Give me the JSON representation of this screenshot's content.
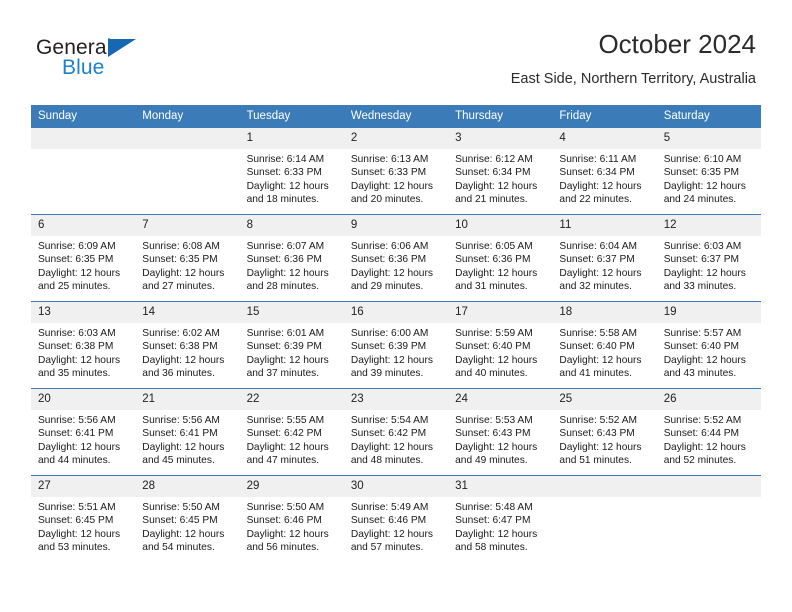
{
  "brand": {
    "name_part1": "General",
    "name_part2": "Blue",
    "triangle_color": "#1668b3",
    "blue_color": "#1b7fd4"
  },
  "header": {
    "title": "October 2024",
    "subtitle": "East Side, Northern Territory, Australia"
  },
  "theme": {
    "header_blue": "#3b7cb8",
    "daynum_band": "#f0f0f0"
  },
  "weekday_headers": [
    "Sunday",
    "Monday",
    "Tuesday",
    "Wednesday",
    "Thursday",
    "Friday",
    "Saturday"
  ],
  "labels": {
    "sunrise_prefix": "Sunrise:",
    "sunset_prefix": "Sunset:",
    "daylight_prefix": "Daylight:"
  },
  "weeks": [
    [
      {
        "day": "",
        "lines": []
      },
      {
        "day": "",
        "lines": []
      },
      {
        "day": "1",
        "lines": [
          "Sunrise: 6:14 AM",
          "Sunset: 6:33 PM",
          "Daylight: 12 hours",
          "and 18 minutes."
        ]
      },
      {
        "day": "2",
        "lines": [
          "Sunrise: 6:13 AM",
          "Sunset: 6:33 PM",
          "Daylight: 12 hours",
          "and 20 minutes."
        ]
      },
      {
        "day": "3",
        "lines": [
          "Sunrise: 6:12 AM",
          "Sunset: 6:34 PM",
          "Daylight: 12 hours",
          "and 21 minutes."
        ]
      },
      {
        "day": "4",
        "lines": [
          "Sunrise: 6:11 AM",
          "Sunset: 6:34 PM",
          "Daylight: 12 hours",
          "and 22 minutes."
        ]
      },
      {
        "day": "5",
        "lines": [
          "Sunrise: 6:10 AM",
          "Sunset: 6:35 PM",
          "Daylight: 12 hours",
          "and 24 minutes."
        ]
      }
    ],
    [
      {
        "day": "6",
        "lines": [
          "Sunrise: 6:09 AM",
          "Sunset: 6:35 PM",
          "Daylight: 12 hours",
          "and 25 minutes."
        ]
      },
      {
        "day": "7",
        "lines": [
          "Sunrise: 6:08 AM",
          "Sunset: 6:35 PM",
          "Daylight: 12 hours",
          "and 27 minutes."
        ]
      },
      {
        "day": "8",
        "lines": [
          "Sunrise: 6:07 AM",
          "Sunset: 6:36 PM",
          "Daylight: 12 hours",
          "and 28 minutes."
        ]
      },
      {
        "day": "9",
        "lines": [
          "Sunrise: 6:06 AM",
          "Sunset: 6:36 PM",
          "Daylight: 12 hours",
          "and 29 minutes."
        ]
      },
      {
        "day": "10",
        "lines": [
          "Sunrise: 6:05 AM",
          "Sunset: 6:36 PM",
          "Daylight: 12 hours",
          "and 31 minutes."
        ]
      },
      {
        "day": "11",
        "lines": [
          "Sunrise: 6:04 AM",
          "Sunset: 6:37 PM",
          "Daylight: 12 hours",
          "and 32 minutes."
        ]
      },
      {
        "day": "12",
        "lines": [
          "Sunrise: 6:03 AM",
          "Sunset: 6:37 PM",
          "Daylight: 12 hours",
          "and 33 minutes."
        ]
      }
    ],
    [
      {
        "day": "13",
        "lines": [
          "Sunrise: 6:03 AM",
          "Sunset: 6:38 PM",
          "Daylight: 12 hours",
          "and 35 minutes."
        ]
      },
      {
        "day": "14",
        "lines": [
          "Sunrise: 6:02 AM",
          "Sunset: 6:38 PM",
          "Daylight: 12 hours",
          "and 36 minutes."
        ]
      },
      {
        "day": "15",
        "lines": [
          "Sunrise: 6:01 AM",
          "Sunset: 6:39 PM",
          "Daylight: 12 hours",
          "and 37 minutes."
        ]
      },
      {
        "day": "16",
        "lines": [
          "Sunrise: 6:00 AM",
          "Sunset: 6:39 PM",
          "Daylight: 12 hours",
          "and 39 minutes."
        ]
      },
      {
        "day": "17",
        "lines": [
          "Sunrise: 5:59 AM",
          "Sunset: 6:40 PM",
          "Daylight: 12 hours",
          "and 40 minutes."
        ]
      },
      {
        "day": "18",
        "lines": [
          "Sunrise: 5:58 AM",
          "Sunset: 6:40 PM",
          "Daylight: 12 hours",
          "and 41 minutes."
        ]
      },
      {
        "day": "19",
        "lines": [
          "Sunrise: 5:57 AM",
          "Sunset: 6:40 PM",
          "Daylight: 12 hours",
          "and 43 minutes."
        ]
      }
    ],
    [
      {
        "day": "20",
        "lines": [
          "Sunrise: 5:56 AM",
          "Sunset: 6:41 PM",
          "Daylight: 12 hours",
          "and 44 minutes."
        ]
      },
      {
        "day": "21",
        "lines": [
          "Sunrise: 5:56 AM",
          "Sunset: 6:41 PM",
          "Daylight: 12 hours",
          "and 45 minutes."
        ]
      },
      {
        "day": "22",
        "lines": [
          "Sunrise: 5:55 AM",
          "Sunset: 6:42 PM",
          "Daylight: 12 hours",
          "and 47 minutes."
        ]
      },
      {
        "day": "23",
        "lines": [
          "Sunrise: 5:54 AM",
          "Sunset: 6:42 PM",
          "Daylight: 12 hours",
          "and 48 minutes."
        ]
      },
      {
        "day": "24",
        "lines": [
          "Sunrise: 5:53 AM",
          "Sunset: 6:43 PM",
          "Daylight: 12 hours",
          "and 49 minutes."
        ]
      },
      {
        "day": "25",
        "lines": [
          "Sunrise: 5:52 AM",
          "Sunset: 6:43 PM",
          "Daylight: 12 hours",
          "and 51 minutes."
        ]
      },
      {
        "day": "26",
        "lines": [
          "Sunrise: 5:52 AM",
          "Sunset: 6:44 PM",
          "Daylight: 12 hours",
          "and 52 minutes."
        ]
      }
    ],
    [
      {
        "day": "27",
        "lines": [
          "Sunrise: 5:51 AM",
          "Sunset: 6:45 PM",
          "Daylight: 12 hours",
          "and 53 minutes."
        ]
      },
      {
        "day": "28",
        "lines": [
          "Sunrise: 5:50 AM",
          "Sunset: 6:45 PM",
          "Daylight: 12 hours",
          "and 54 minutes."
        ]
      },
      {
        "day": "29",
        "lines": [
          "Sunrise: 5:50 AM",
          "Sunset: 6:46 PM",
          "Daylight: 12 hours",
          "and 56 minutes."
        ]
      },
      {
        "day": "30",
        "lines": [
          "Sunrise: 5:49 AM",
          "Sunset: 6:46 PM",
          "Daylight: 12 hours",
          "and 57 minutes."
        ]
      },
      {
        "day": "31",
        "lines": [
          "Sunrise: 5:48 AM",
          "Sunset: 6:47 PM",
          "Daylight: 12 hours",
          "and 58 minutes."
        ]
      },
      {
        "day": "",
        "lines": []
      },
      {
        "day": "",
        "lines": []
      }
    ]
  ]
}
